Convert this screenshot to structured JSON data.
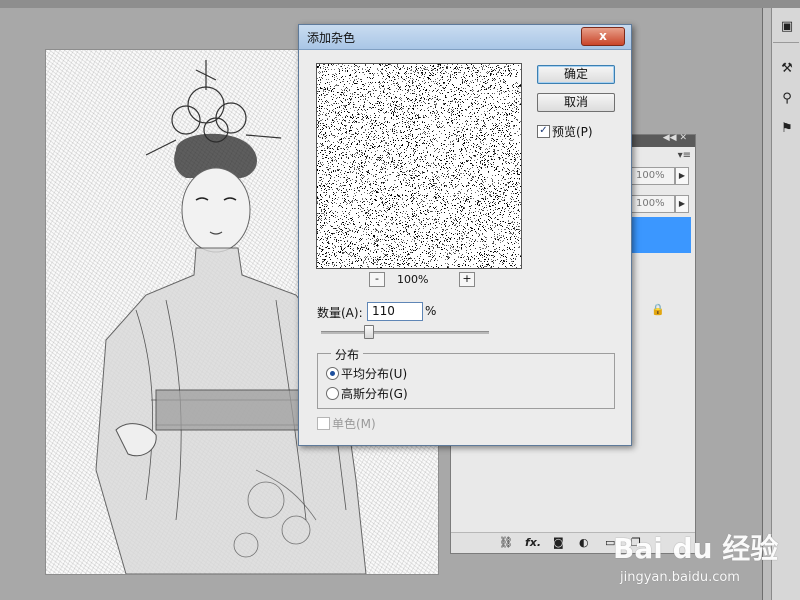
{
  "dialog": {
    "title": "添加杂色",
    "close_symbol": "x",
    "ok_label": "确定",
    "cancel_label": "取消",
    "preview_label": "预览(P)",
    "preview_checked": true,
    "zoom_minus": "-",
    "zoom_plus": "+",
    "zoom_value": "100%",
    "amount_label": "数量(A):",
    "amount_value": "110",
    "amount_unit": "%",
    "distribution_title": "分布",
    "uniform_label": "平均分布(U)",
    "gaussian_label": "高斯分布(G)",
    "selected_distribution": "uniform",
    "mono_label": "单色(M)",
    "mono_checked": false
  },
  "layers_panel": {
    "opacity_value": "100%",
    "fill_value": "100%",
    "collapse_icon": "double-chevron-icon",
    "menu_icon": "panel-menu-icon",
    "footer_icons": [
      "link-icon",
      "fx-icon",
      "mask-icon",
      "adjustment-icon",
      "folder-icon",
      "new-layer-icon"
    ]
  },
  "right_dock": {
    "tools": [
      "history-icon",
      "brush-icon",
      "clone-icon",
      "stamp-icon"
    ]
  },
  "watermark": {
    "logo": "Bai du 经验",
    "url": "jingyan.baidu.com"
  },
  "colors": {
    "selection_blue": "#3b97ff",
    "titlebar": "#b7cfe9",
    "close_red": "#c9452a"
  }
}
